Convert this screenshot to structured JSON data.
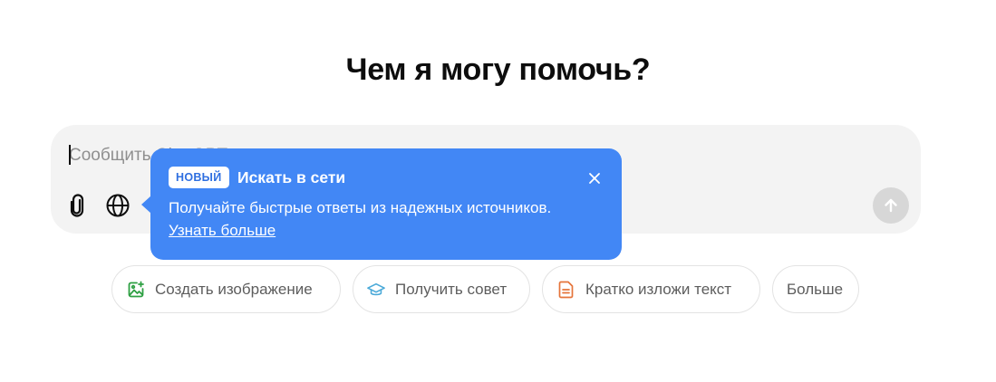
{
  "heading": "Чем я могу помочь?",
  "composer": {
    "placeholder": "Сообщить ChatGPT",
    "attach_icon": "paperclip-icon",
    "web_icon": "globe-icon",
    "send_icon": "arrow-up-icon"
  },
  "popover": {
    "badge": "НОВЫЙ",
    "title": "Искать в сети",
    "body": "Получайте быстрые ответы из надежных источников.",
    "link": "Узнать больше",
    "close_icon": "close-icon",
    "color": "#4287f5"
  },
  "suggestions": [
    {
      "label": "Создать изображение",
      "icon": "image-icon",
      "color": "#2ea043"
    },
    {
      "label": "Получить совет",
      "icon": "graduation-cap-icon",
      "color": "#4aa9d8"
    },
    {
      "label": "Кратко изложи текст",
      "icon": "document-icon",
      "color": "#e5743a"
    },
    {
      "label": "Больше",
      "icon": null,
      "color": null
    }
  ]
}
